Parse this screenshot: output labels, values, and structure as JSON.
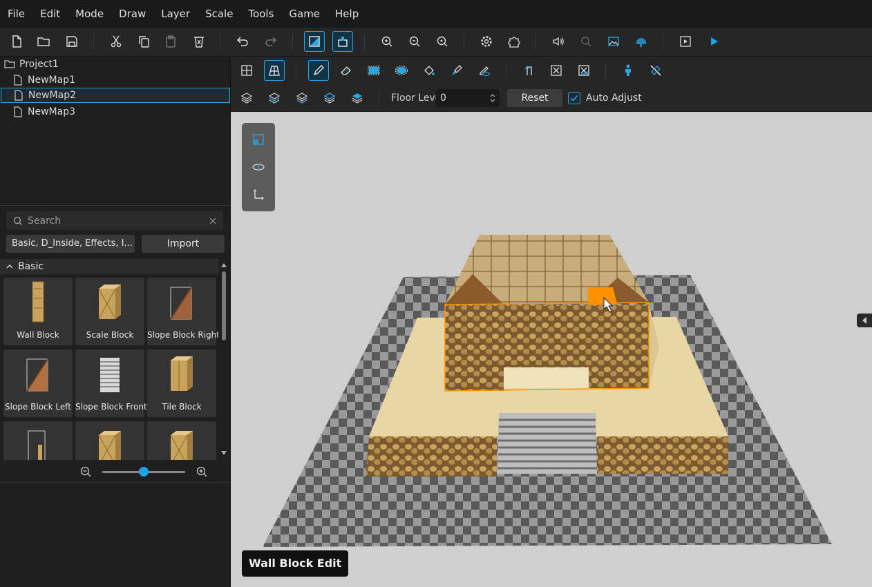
{
  "menu": [
    "File",
    "Edit",
    "Mode",
    "Draw",
    "Layer",
    "Scale",
    "Tools",
    "Game",
    "Help"
  ],
  "project": {
    "root": "Project1",
    "maps": [
      "NewMap1",
      "NewMap2",
      "NewMap3"
    ],
    "selected_map": "NewMap2"
  },
  "assets": {
    "search_placeholder": "Search",
    "filter": "Basic, D_Inside, Effects, I...",
    "import_label": "Import",
    "section": "Basic",
    "items": [
      "Wall Block",
      "Scale Block",
      "Slope Block Right",
      "Slope Block Left",
      "Slope Block Front",
      "Tile Block",
      "",
      "",
      ""
    ]
  },
  "zoom_slider_value": 0.5,
  "floor": {
    "label": "Floor Level",
    "value": "0",
    "reset_label": "Reset",
    "auto_adjust_label": "Auto Adjust",
    "auto_adjust_checked": true
  },
  "viewport": {
    "mode_label": "Wall Block Edit"
  },
  "colors": {
    "accent": "#2aa7e0",
    "selection": "#ff9000"
  }
}
